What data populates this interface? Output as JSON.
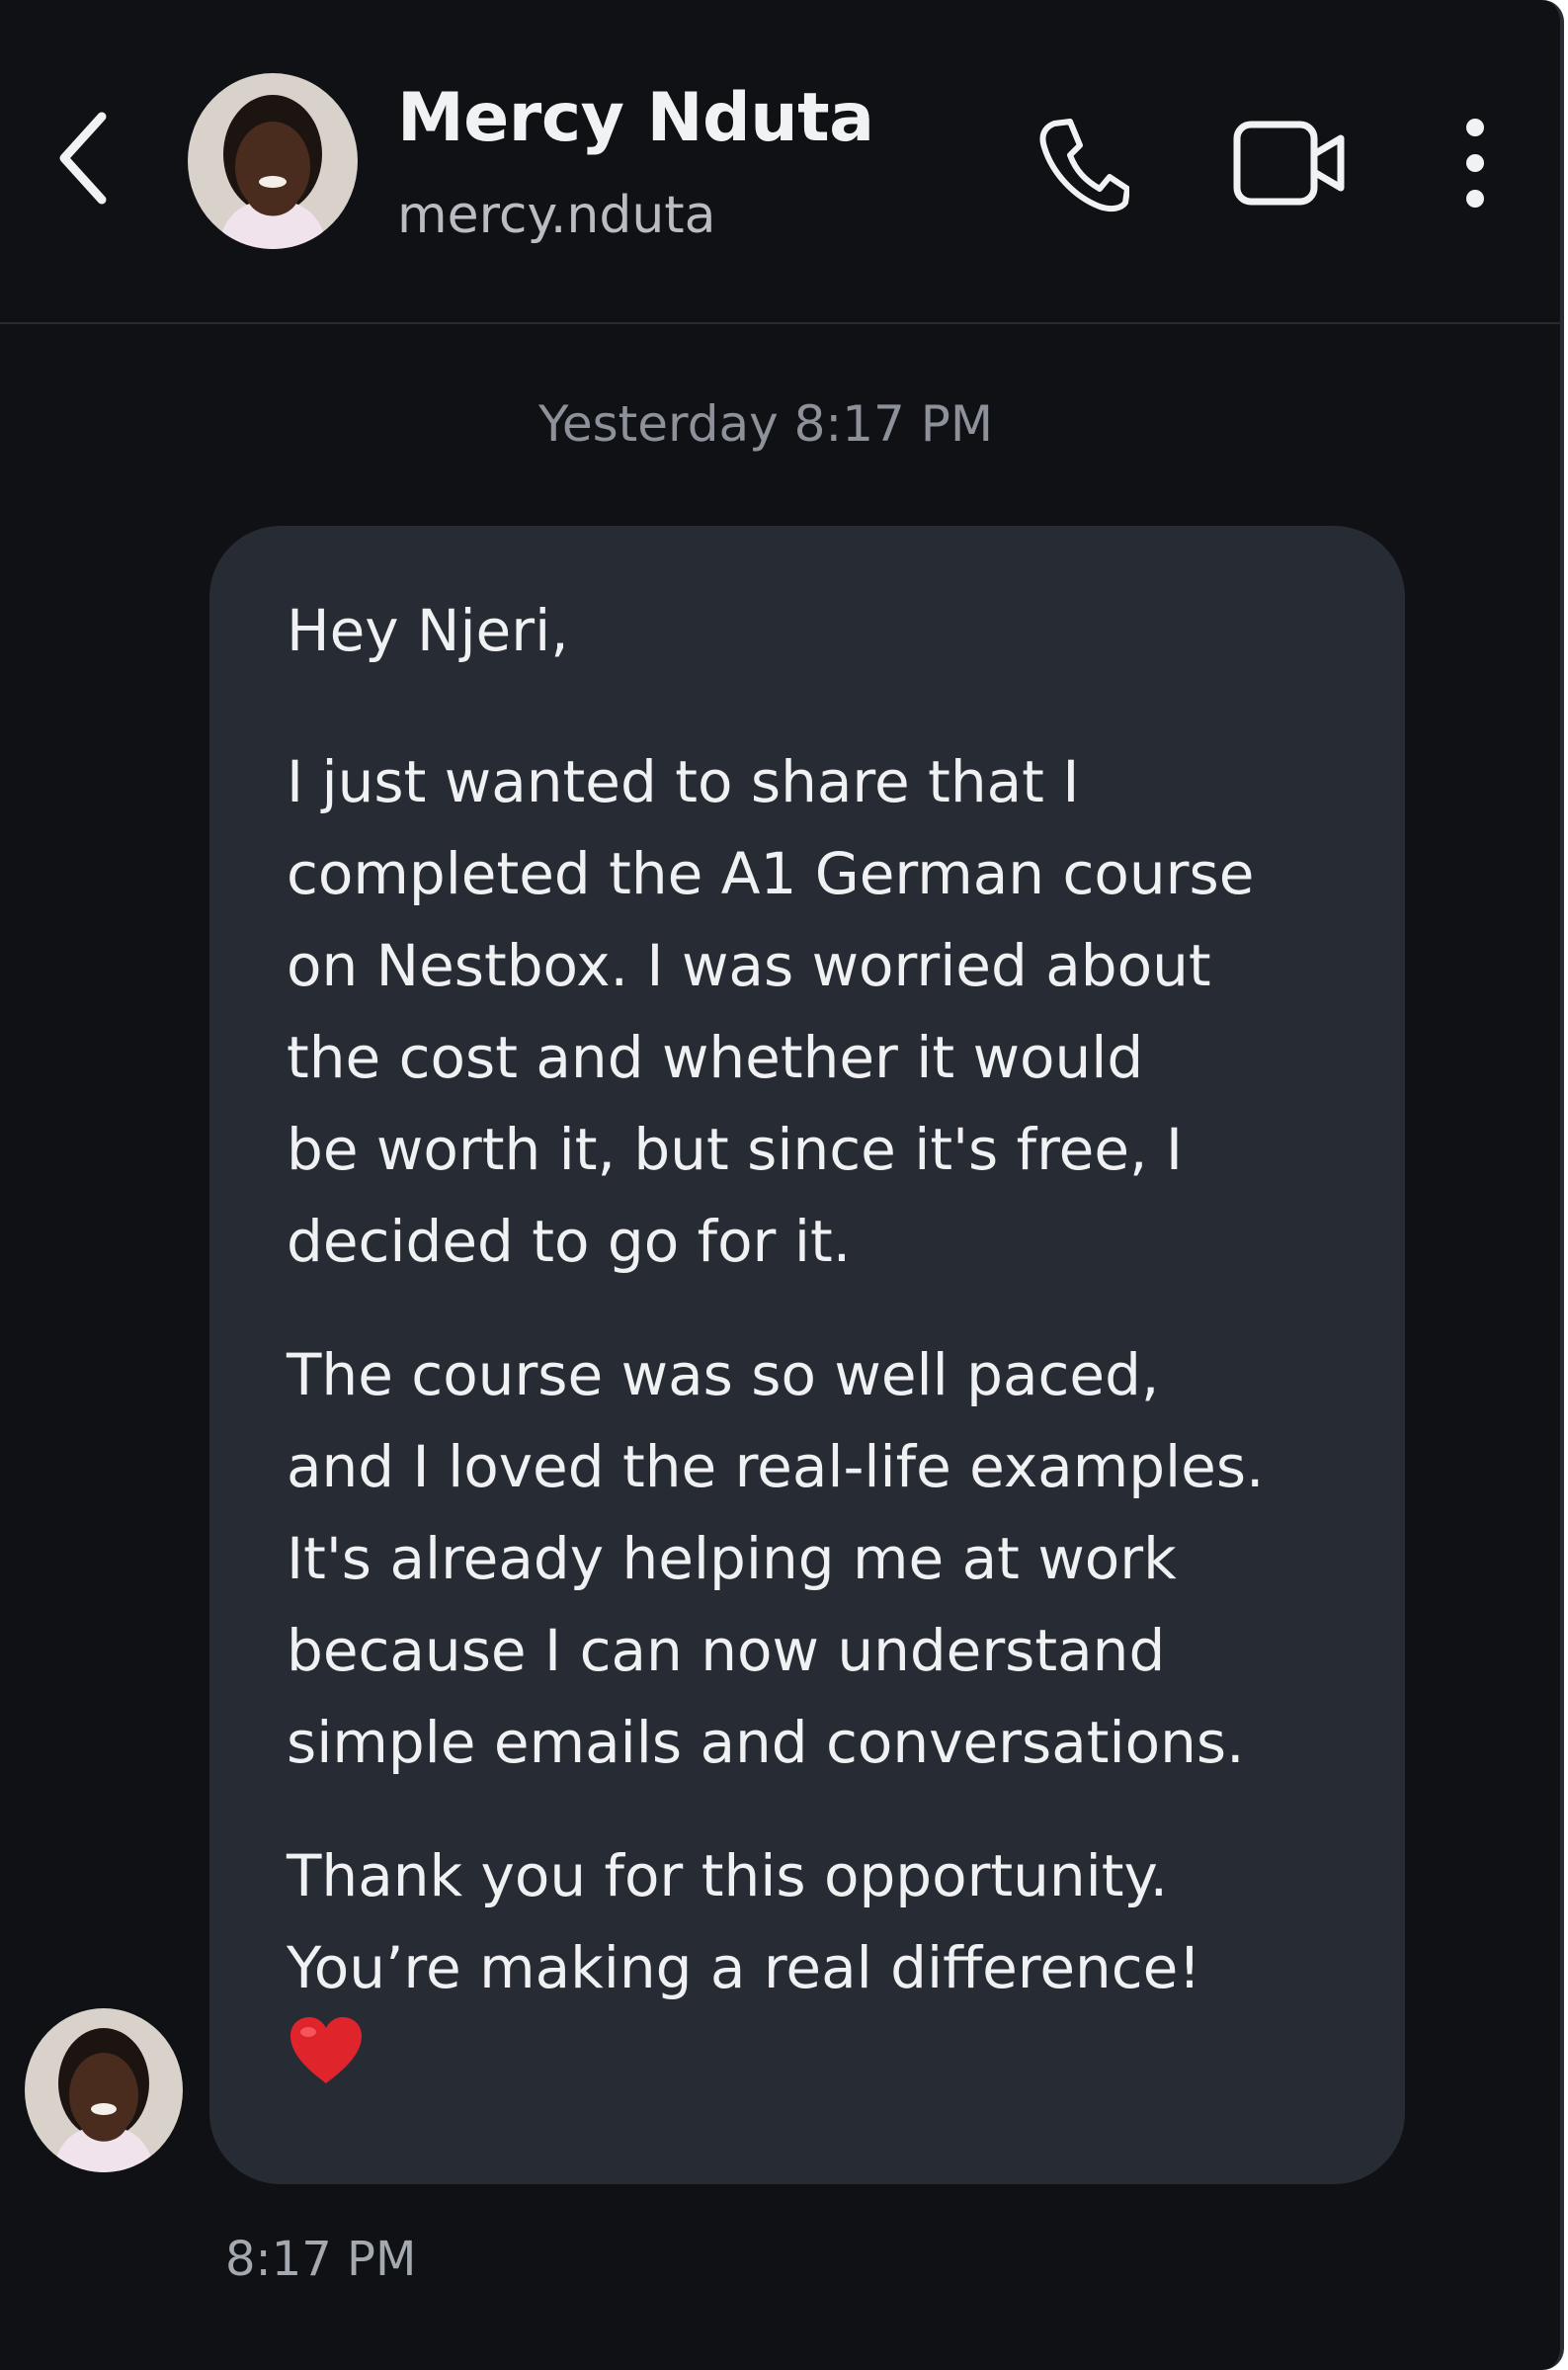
{
  "contact": {
    "name": "Mercy Nduta",
    "handle": "mercy.nduta"
  },
  "header": {
    "back_icon": "chevron-left-icon",
    "call_icon": "phone-icon",
    "video_icon": "video-camera-icon",
    "more_icon": "more-vertical-icon"
  },
  "conversation": {
    "date_divider": "Yesterday 8:17 PM",
    "message": {
      "greeting": "Hey Njeri,",
      "paragraph1": "I just wanted to share that I\ncompleted the A1 German course\non Nestbox. I was worried about\nthe cost and whether it would\nbe worth it, but since it's free, I\ndecided to go for it.",
      "paragraph2": "The course was so well paced,\nand I loved the real-life examples.\nIt's already helping me at work\nbecause I can now understand\nsimple emails and conversations.",
      "paragraph3": "Thank you for this opportunity.\nYou’re making a real difference!",
      "emoji": "❤️",
      "time": "8:17 PM"
    }
  },
  "colors": {
    "background": "#0f1115",
    "bubble": "#272b33",
    "text_primary": "#f0f1f3",
    "text_secondary": "#8d9199",
    "heart": "#e0242b"
  }
}
